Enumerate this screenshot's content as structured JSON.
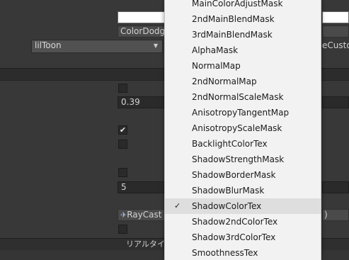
{
  "inspector": {
    "blend_mode_field": "ColorDodge",
    "shader_dropdown": "lilToon",
    "right_field_fragment": "eCustom",
    "float_value_1": "0.39",
    "int_value_1": "5",
    "raycast_field": "RayCast",
    "raycast_right_fragment": ")",
    "realtime_bar_label": "リアルタイム"
  },
  "menu": {
    "items": [
      {
        "label": "MainColorAdjustMask",
        "checked": false,
        "hover": false
      },
      {
        "label": "2ndMainBlendMask",
        "checked": false,
        "hover": false
      },
      {
        "label": "3rdMainBlendMask",
        "checked": false,
        "hover": false
      },
      {
        "label": "AlphaMask",
        "checked": false,
        "hover": false
      },
      {
        "label": "NormalMap",
        "checked": false,
        "hover": false
      },
      {
        "label": "2ndNormalMap",
        "checked": false,
        "hover": false
      },
      {
        "label": "2ndNormalScaleMask",
        "checked": false,
        "hover": false
      },
      {
        "label": "AnisotropyTangentMap",
        "checked": false,
        "hover": false
      },
      {
        "label": "AnisotropyScaleMask",
        "checked": false,
        "hover": false
      },
      {
        "label": "BacklightColorTex",
        "checked": false,
        "hover": false
      },
      {
        "label": "ShadowStrengthMask",
        "checked": false,
        "hover": false
      },
      {
        "label": "ShadowBorderMask",
        "checked": false,
        "hover": false
      },
      {
        "label": "ShadowBlurMask",
        "checked": false,
        "hover": false
      },
      {
        "label": "ShadowColorTex",
        "checked": true,
        "hover": true
      },
      {
        "label": "Shadow2ndColorTex",
        "checked": false,
        "hover": false
      },
      {
        "label": "Shadow3rdColorTex",
        "checked": false,
        "hover": false
      },
      {
        "label": "SmoothnessTex",
        "checked": false,
        "hover": false
      }
    ]
  },
  "colors": {
    "panel_bg": "#383838",
    "menu_bg": "#f2f2f2",
    "menu_hover": "#dedede"
  }
}
